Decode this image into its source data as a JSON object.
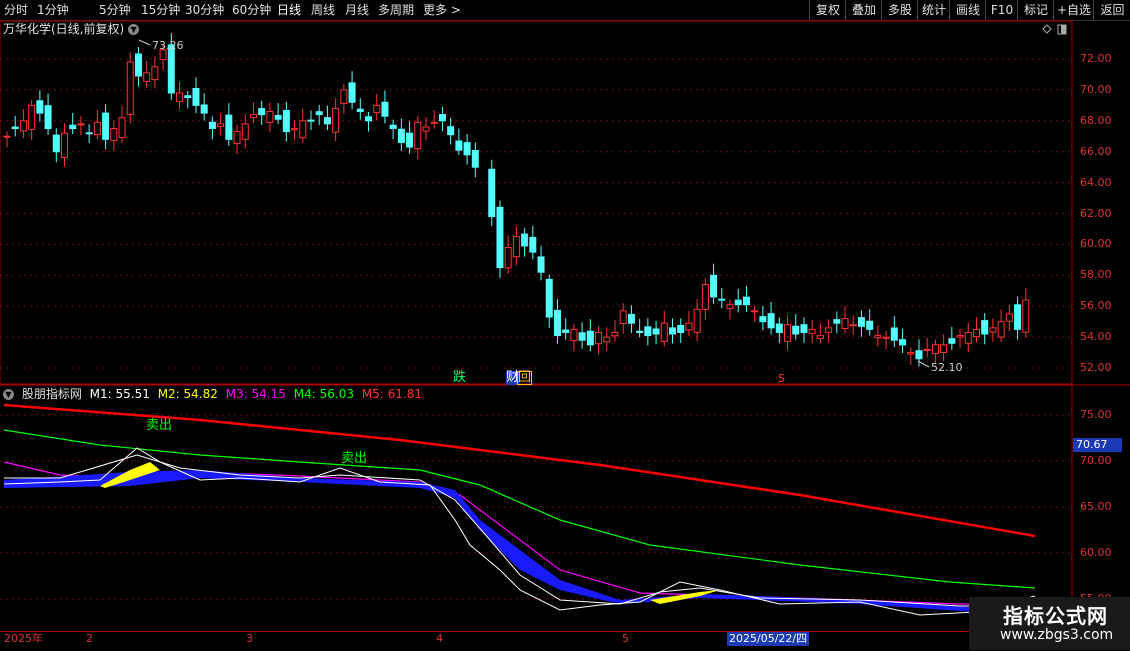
{
  "toolbar": {
    "left": [
      "分时",
      "1分钟",
      "5分钟",
      "15分钟",
      "30分钟",
      "60分钟",
      "日线",
      "周线",
      "月线",
      "多周期",
      "更多 >"
    ],
    "right": [
      "复权",
      "叠加",
      "多股",
      "统计",
      "画线",
      "F10",
      "标记",
      "+自选",
      "返回"
    ],
    "active": "日线"
  },
  "stock_title": "万华化学(日线,前复权)",
  "price_panel": {
    "y_ticks": [
      "72.00",
      "70.00",
      "68.00",
      "66.00",
      "64.00",
      "62.00",
      "60.00",
      "58.00",
      "56.00",
      "54.00",
      "52.00"
    ],
    "high_label": "73.26",
    "low_label": "52.10",
    "flags": {
      "die": "跌",
      "cai": "财",
      "hui": "回",
      "s": "S"
    }
  },
  "indicator": {
    "name": "股朋指标网",
    "m1": "M1: 55.51",
    "m2": "M2: 54.82",
    "m3": "M3: 54.15",
    "m4": "M4: 56.03",
    "m5": "M5: 61.81",
    "y_ticks": [
      "75.00",
      "70.00",
      "65.00",
      "60.00",
      "55.00"
    ],
    "current_value": "70.67",
    "sell_label": "卖出"
  },
  "date_axis": {
    "labels": [
      "2025年",
      "2",
      "3",
      "4",
      "5"
    ],
    "cursor_date": "2025/05/22/四"
  },
  "watermark": {
    "title": "指标公式网",
    "url": "www.zbgs3.com"
  },
  "colors": {
    "up": "#ff3333",
    "down": "#54ffff",
    "m1": "#ffffff",
    "m2": "#ffff00",
    "m3": "#ff00ff",
    "m4": "#00ff00",
    "m5": "#ff0000",
    "fill_blue": "#1a1aff"
  }
}
